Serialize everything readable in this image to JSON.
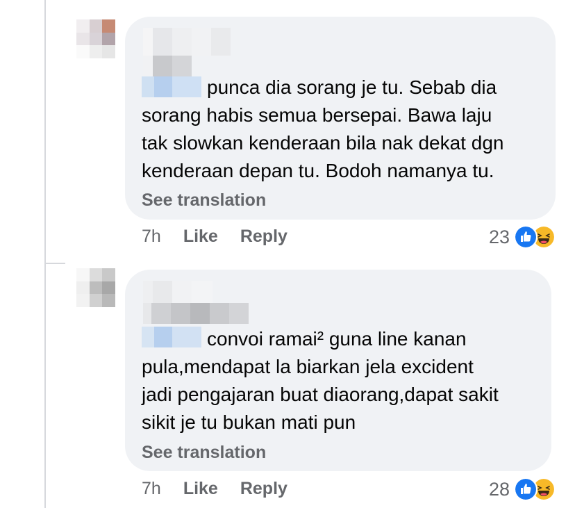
{
  "comments": [
    {
      "text_line_1": "punca dia sorang je tu. Sebab dia",
      "text_line_2": "sorang habis semua bersepai. Bawa laju",
      "text_line_3": "tak slowkan kenderaan bila nak dekat dgn",
      "text_line_4": "kenderaan depan tu. Bodoh namanya tu.",
      "see_translation": "See translation",
      "time": "7h",
      "like_label": "Like",
      "reply_label": "Reply",
      "reaction_count": "23",
      "reaction_icons": [
        "like-icon",
        "haha-icon"
      ]
    },
    {
      "text_line_1": "convoi ramai² guna line kanan",
      "text_line_2": "pula,mendapat la biarkan jela excident",
      "text_line_3": "jadi pengajaran buat diaorang,dapat sakit",
      "text_line_4": "sikit je tu bukan mati pun",
      "see_translation": "See translation",
      "time": "7h",
      "like_label": "Like",
      "reply_label": "Reply",
      "reaction_count": "28",
      "reaction_icons": [
        "like-icon",
        "haha-icon"
      ]
    }
  ],
  "colors": {
    "bubble": "#f0f2f5",
    "secondary_text": "#65676b",
    "like_blue": "#1877f2",
    "haha_yellow": "#f7b928"
  }
}
